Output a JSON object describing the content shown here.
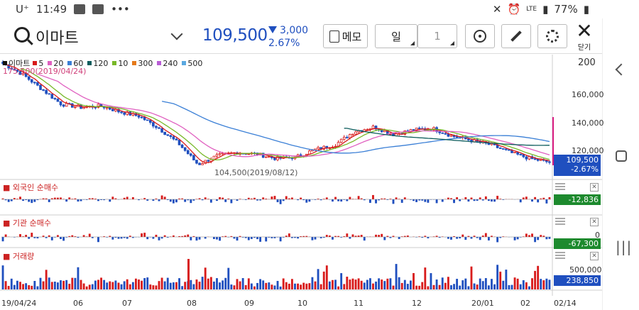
{
  "statusbar": {
    "carrier": "U⁺",
    "time": "11:49",
    "network": "LTE",
    "battery": "77%"
  },
  "header": {
    "stock_name": "이마트",
    "price": "109,500",
    "change_amount": "3,000",
    "change_rate": "2.67%",
    "memo_label": "메모",
    "period_label": "일",
    "count_value": "1",
    "close_label": "닫기"
  },
  "legend": {
    "stock": "이마트",
    "mas": [
      {
        "label": "5",
        "color": "#d81b1b"
      },
      {
        "label": "20",
        "color": "#e060c0"
      },
      {
        "label": "60",
        "color": "#3a7fd6"
      },
      {
        "label": "120",
        "color": "#0c5c5c"
      },
      {
        "label": "10",
        "color": "#78b828"
      },
      {
        "label": "300",
        "color": "#e57a1a"
      },
      {
        "label": "240",
        "color": "#b95cd6"
      },
      {
        "label": "500",
        "color": "#5aa8e0"
      }
    ]
  },
  "price_chart": {
    "high_annotation": "175,500(2019/04/24)",
    "low_annotation": "104,500(2019/08/12)",
    "y_top_label": "200",
    "y_ticks": [
      "160,000",
      "140,000",
      "120,000"
    ],
    "current_tag": "109,500",
    "current_tag_rate": "-2.67%"
  },
  "foreign_panel": {
    "title": "외국인 순매수",
    "value": "-12,836"
  },
  "inst_panel": {
    "title": "기관 순매수",
    "zero": "0",
    "value": "-67,300"
  },
  "volume_panel": {
    "title": "거래량",
    "tick": "500,000",
    "value": "238,850"
  },
  "x_axis": [
    "19/04/24",
    "06",
    "07",
    "08",
    "09",
    "10",
    "11",
    "12",
    "20/01",
    "02",
    "02/14"
  ],
  "colors": {
    "up": "#d81b1b",
    "down": "#1f4fbf",
    "accent": "#1f4fbf"
  },
  "chart_data": {
    "type": "candlestick",
    "title": "이마트",
    "high": {
      "price": 175500,
      "date": "2019/04/24"
    },
    "low": {
      "price": 104500,
      "date": "2019/08/12"
    },
    "x": [
      "19/04/24",
      "06",
      "07",
      "08",
      "09",
      "10",
      "11",
      "12",
      "20/01",
      "02",
      "02/14"
    ],
    "close_series": [
      175000,
      168000,
      158000,
      148000,
      146000,
      147000,
      143000,
      140000,
      132000,
      122000,
      108000,
      114000,
      116000,
      115000,
      112000,
      113000,
      118000,
      121000,
      130000,
      133000,
      128000,
      131000,
      132000,
      127000,
      124000,
      121000,
      116000,
      112000,
      109500
    ],
    "ylim": [
      100000,
      180000
    ],
    "y_ticks": [
      120000,
      140000,
      160000
    ],
    "current": 109500
  }
}
